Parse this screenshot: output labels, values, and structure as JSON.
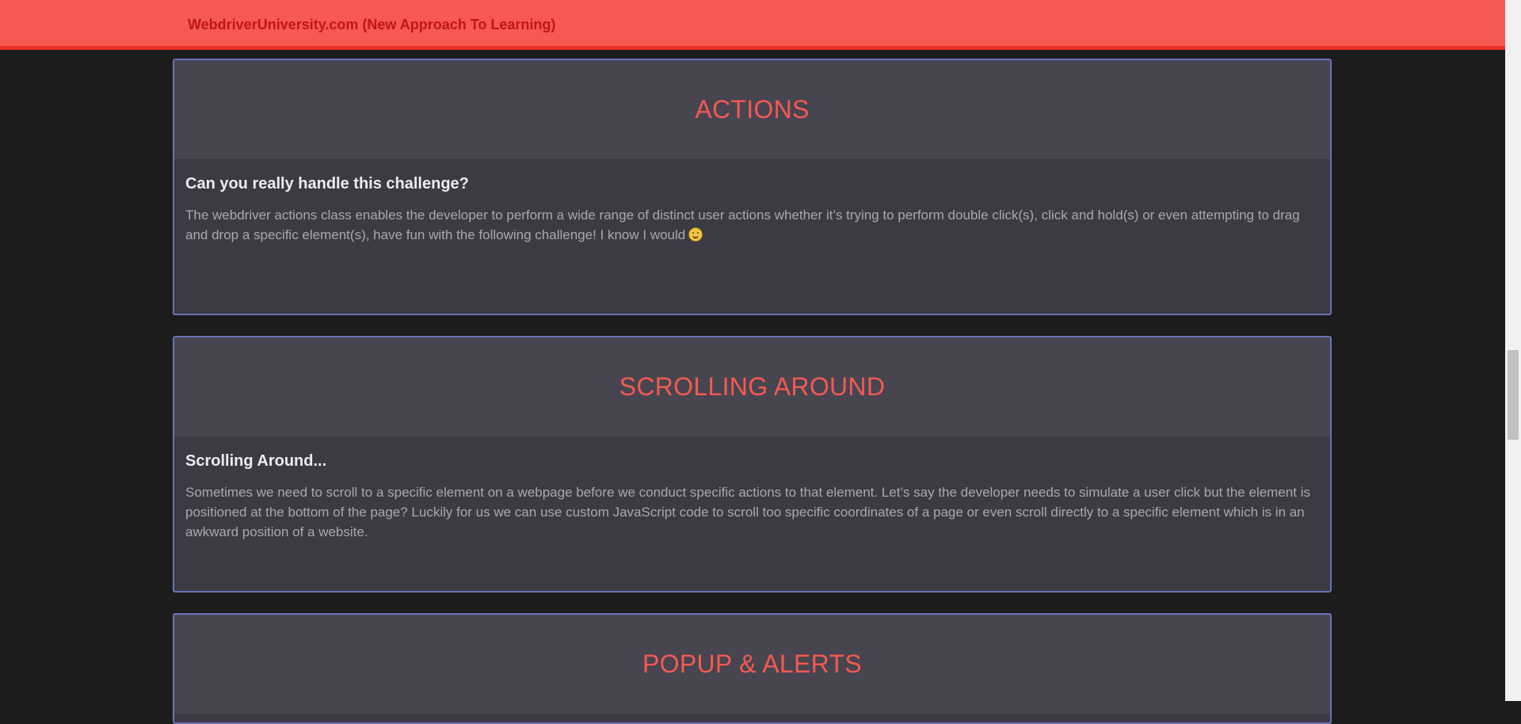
{
  "navbar": {
    "brand": "WebdriverUniversity.com (New Approach To Learning)"
  },
  "cards": [
    {
      "title": "ACTIONS",
      "subtitle": "Can you really handle this challenge?",
      "text": "The webdriver actions class enables the developer to perform a wide range of distinct user actions whether it’s trying to perform double click(s), click and hold(s) or even attempting to drag and drop a specific element(s), have fun with the following challenge! I know I would",
      "icon": "smiley-emoji-icon"
    },
    {
      "title": "SCROLLING AROUND",
      "subtitle": "Scrolling Around...",
      "text": "Sometimes we need to scroll to a specific element on a webpage before we conduct specific actions to that element. Let’s say the developer needs to simulate a user click but the element is positioned at the bottom of the page? Luckily for us we can use custom JavaScript code to scroll too specific coordinates of a page or even scroll directly to a specific element which is in an awkward position of a website."
    },
    {
      "title": "POPUP & ALERTS"
    }
  ],
  "colors": {
    "navbar": "#f55951",
    "brand_text": "#c0151a",
    "card_title": "#f55951",
    "card_border": "#6a72b8",
    "page_background": "#1c1c1c"
  }
}
